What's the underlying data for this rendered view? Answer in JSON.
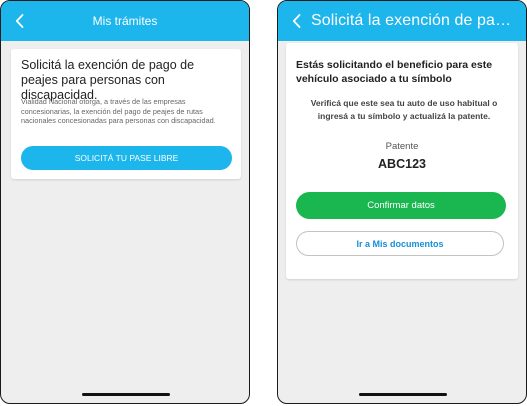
{
  "colors": {
    "accent": "#1cb5ec",
    "confirm_green": "#1ab650",
    "link_blue": "#1590d6",
    "screen_background": "#eeeeee"
  },
  "left_screen": {
    "header": {
      "back_icon": "chevron-left-icon",
      "title": "Mis trámites"
    },
    "card": {
      "title": "Solicitá la exención de pago de peajes para personas con discapacidad.",
      "description": "Vialidad Nacional otorga, a través de las empresas concesionarias, la exención del pago de peajes de rutas nacionales concesionadas para personas con discapacidad.",
      "button_label": "SOLICITÁ TU PASE LIBRE"
    }
  },
  "right_screen": {
    "header": {
      "back_icon": "chevron-left-icon",
      "title": "Solicitá la exención de pago de..."
    },
    "card": {
      "title": "Estás solicitando el beneficio para este vehículo asociado a tu símbolo",
      "description": "Verificá que este sea tu auto de uso habitual o ingresá a tu símbolo y actualizá la patente.",
      "patente_label": "Patente",
      "patente_value": "ABC123",
      "confirm_button_label": "Confirmar datos",
      "documents_button_label": "Ir a Mis documentos"
    }
  }
}
